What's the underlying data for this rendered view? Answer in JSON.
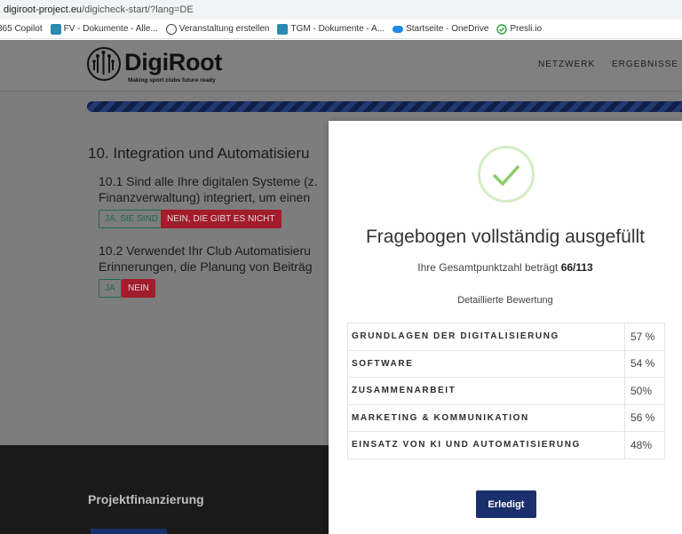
{
  "browser": {
    "url_host": "digiroot-project.eu",
    "url_path": "/digicheck-start/?lang=DE",
    "bookmarks": [
      {
        "label": "365 Copilot",
        "icon": "copilot-icon"
      },
      {
        "label": "FV - Dokumente - Alle...",
        "icon": "teams-icon"
      },
      {
        "label": "Veranstaltung erstellen",
        "icon": "globe-icon"
      },
      {
        "label": "TGM - Dokumente - A...",
        "icon": "teams-icon"
      },
      {
        "label": "Startseite - OneDrive",
        "icon": "onedrive-icon"
      },
      {
        "label": "Presli.io",
        "icon": "check-circle-icon"
      }
    ]
  },
  "header": {
    "logo_text": "DigiRoot",
    "logo_tagline": "Making sport clubs future ready",
    "nav": [
      "NETZWERK",
      "ERGEBNISSE"
    ]
  },
  "survey": {
    "section_title": "10. Integration und Automatisieru",
    "q1_line1": "10.1 Sind alle Ihre digitalen Systeme (z.",
    "q1_line2": "Finanzverwaltung) integriert, um einen",
    "q1_yes": "JA, SIE SIND",
    "q1_no": "NEIN, DIE GIBT ES NICHT",
    "q2_line1": "10.2 Verwendet Ihr Club Automatisieru",
    "q2_line2": "Erinnerungen, die Planung von Beiträg",
    "q2_yes": "JA",
    "q2_no": "NEIN"
  },
  "footer": {
    "title": "Projektfinanzierung"
  },
  "modal": {
    "title": "Fragebogen vollständig ausgefüllt",
    "score_prefix": "Ihre Gesamtpunktzahl beträgt ",
    "score_value": "66/113",
    "detail_label": "Detaillierte Bewertung",
    "rows": [
      {
        "category": "GRUNDLAGEN DER DIGITALISIERUNG",
        "percent": "57 %"
      },
      {
        "category": "SOFTWARE",
        "percent": "54 %"
      },
      {
        "category": "ZUSAMMENARBEIT",
        "percent": "50%"
      },
      {
        "category": "MARKETING & KOMMUNIKATION",
        "percent": "56 %"
      },
      {
        "category": "EINSATZ VON KI UND AUTOMATISIERUNG",
        "percent": "48%"
      }
    ],
    "done_label": "Erledigt"
  },
  "colors": {
    "primary": "#1a2f6b",
    "danger": "#a21c2b",
    "success_outline": "#1e6b4a",
    "check_green": "#8ccd6c"
  }
}
